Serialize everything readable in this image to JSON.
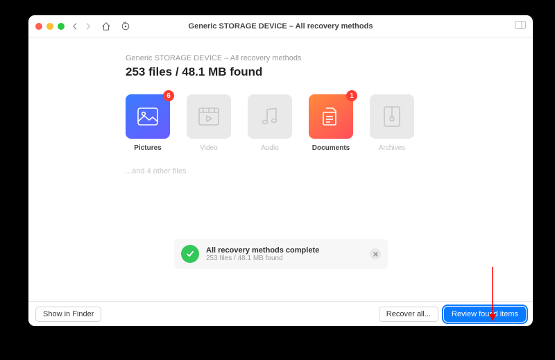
{
  "toolbar": {
    "title": "Generic STORAGE DEVICE – All recovery methods"
  },
  "breadcrumb": "Generic STORAGE DEVICE – All recovery methods",
  "headline": "253 files / 48.1 MB found",
  "categories": {
    "pictures": {
      "label": "Pictures",
      "badge": "6"
    },
    "video": {
      "label": "Video"
    },
    "audio": {
      "label": "Audio"
    },
    "documents": {
      "label": "Documents",
      "badge": "1"
    },
    "archives": {
      "label": "Archives"
    }
  },
  "other_files": "...and 4 other files",
  "complete": {
    "title": "All recovery methods complete",
    "subtitle": "253 files / 48.1 MB found"
  },
  "footer": {
    "show_in_finder": "Show in Finder",
    "recover_all": "Recover all...",
    "review": "Review found items"
  }
}
